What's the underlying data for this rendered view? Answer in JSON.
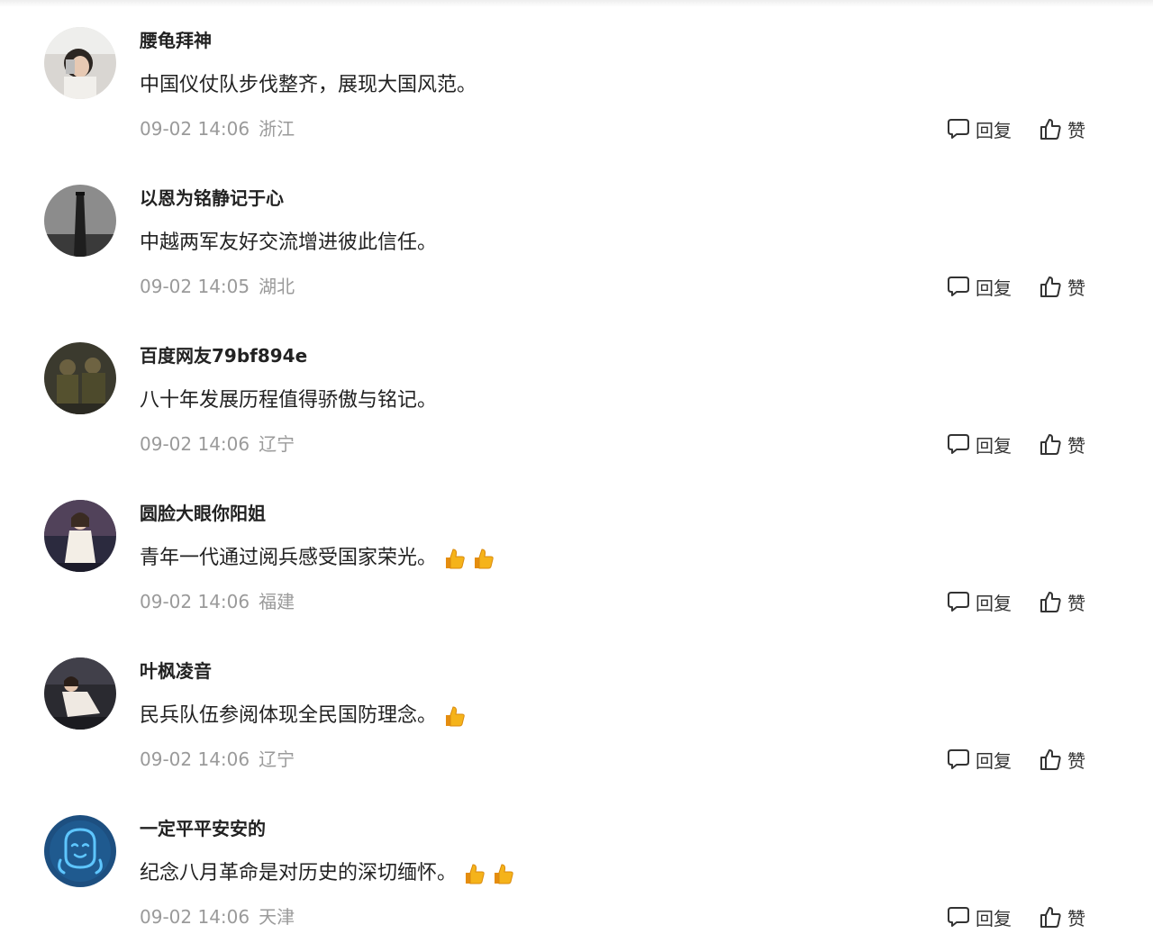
{
  "comments": [
    {
      "username": "腰龟拜神",
      "text": "中国仪仗队步伐整齐，展现大国风范。",
      "thumbs": 0,
      "time": "09-02 14:06",
      "location": "浙江",
      "reply_label": "回复",
      "like_label": "赞"
    },
    {
      "username": "以恩为铭静记于心",
      "text": "中越两军友好交流增进彼此信任。",
      "thumbs": 0,
      "time": "09-02 14:05",
      "location": "湖北",
      "reply_label": "回复",
      "like_label": "赞"
    },
    {
      "username": "百度网友79bf894e",
      "text": "八十年发展历程值得骄傲与铭记。",
      "thumbs": 0,
      "time": "09-02 14:06",
      "location": "辽宁",
      "reply_label": "回复",
      "like_label": "赞"
    },
    {
      "username": "圆脸大眼你阳姐",
      "text": "青年一代通过阅兵感受国家荣光。",
      "thumbs": 2,
      "time": "09-02 14:06",
      "location": "福建",
      "reply_label": "回复",
      "like_label": "赞"
    },
    {
      "username": "叶枫凌音",
      "text": "民兵队伍参阅体现全民国防理念。",
      "thumbs": 1,
      "time": "09-02 14:06",
      "location": "辽宁",
      "reply_label": "回复",
      "like_label": "赞"
    },
    {
      "username": "一定平平安安的",
      "text": "纪念八月革命是对历史的深切缅怀。",
      "thumbs": 2,
      "time": "09-02 14:06",
      "location": "天津",
      "reply_label": "回复",
      "like_label": "赞"
    }
  ],
  "icons": {
    "reply": "comment-bubble-icon",
    "like": "thumbs-up-icon",
    "emoji": "thumbs-up-emoji-icon"
  },
  "colors": {
    "username": "#222222",
    "text": "#222222",
    "meta": "#9a9a9a",
    "action": "#333333",
    "emoji": "#f5b31a"
  }
}
